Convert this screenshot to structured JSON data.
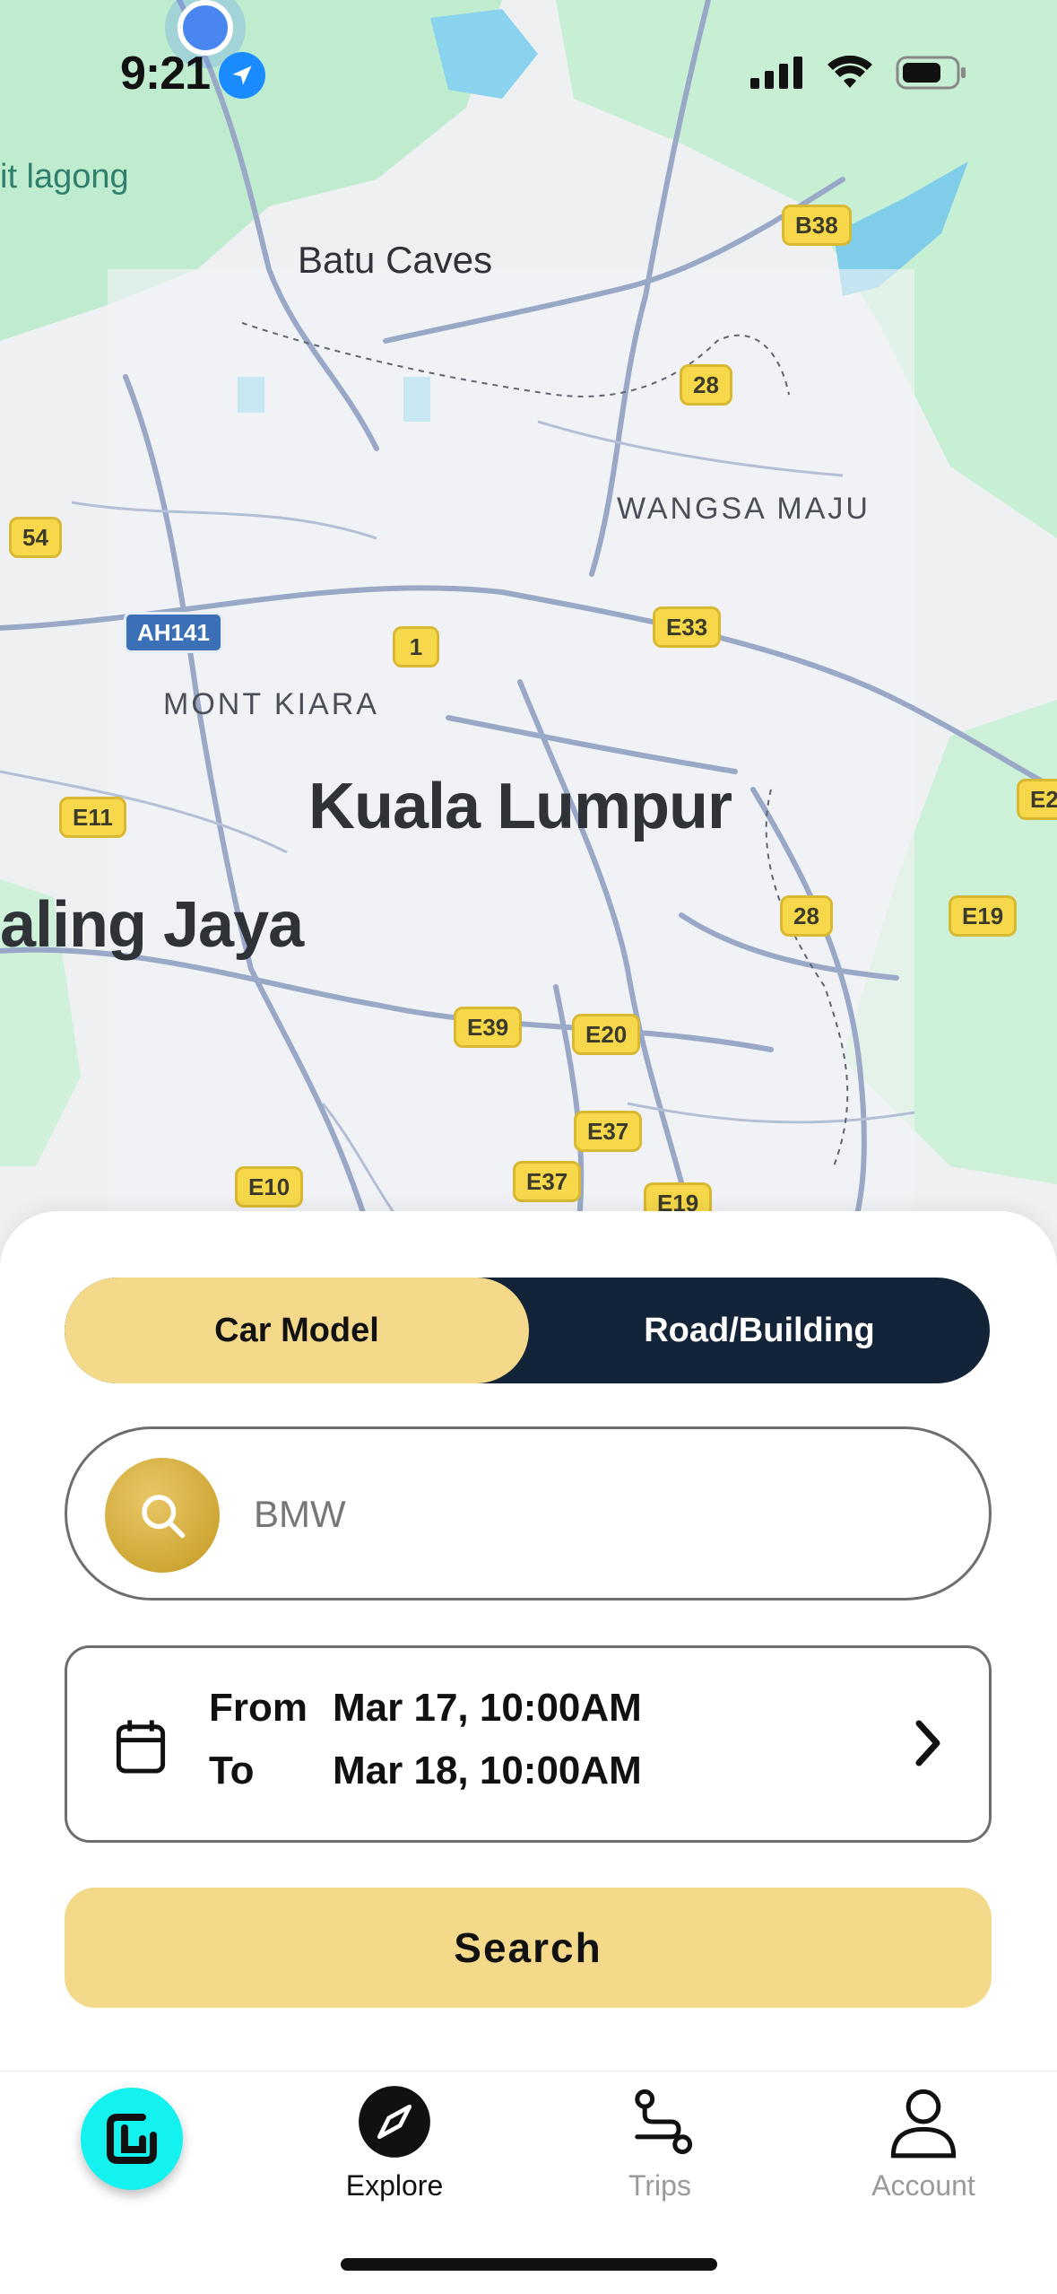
{
  "status_bar": {
    "time": "9:21"
  },
  "map": {
    "labels": {
      "park": "it lagong",
      "batu_caves": "Batu Caves",
      "wangsa_maju": "WANGSA MAJU",
      "mont_kiara": "MONT KIARA",
      "kuala_lumpur": "Kuala Lumpur",
      "petaling_jaya": "aling Jaya"
    },
    "shields": {
      "b38": "B38",
      "r28a": "28",
      "r54": "54",
      "ah141": "AH141",
      "r1": "1",
      "e33": "E33",
      "e11": "E11",
      "e2": "E2",
      "r28b": "28",
      "e19a": "E19",
      "e39": "E39",
      "e20": "E20",
      "e37a": "E37",
      "e37b": "E37",
      "e10": "E10",
      "e19b": "E19"
    }
  },
  "search_panel": {
    "toggle": {
      "car_model": "Car Model",
      "road_building": "Road/Building",
      "active": "car_model"
    },
    "search": {
      "value": "BMW",
      "icon": "search-icon"
    },
    "dates": {
      "from_label": "From",
      "from_value": "Mar 17, 10:00AM",
      "to_label": "To",
      "to_value": "Mar 18, 10:00AM"
    },
    "search_button": "Search"
  },
  "tab_bar": {
    "tabs": [
      {
        "label": "Explore",
        "icon": "compass-icon",
        "active": true
      },
      {
        "label": "Trips",
        "icon": "route-icon",
        "active": false
      },
      {
        "label": "Account",
        "icon": "person-icon",
        "active": false
      }
    ]
  },
  "colors": {
    "accent": "#f5d98b",
    "dark": "#132338",
    "brand": "#13f2ee",
    "map_road": "#9aa8c8"
  }
}
